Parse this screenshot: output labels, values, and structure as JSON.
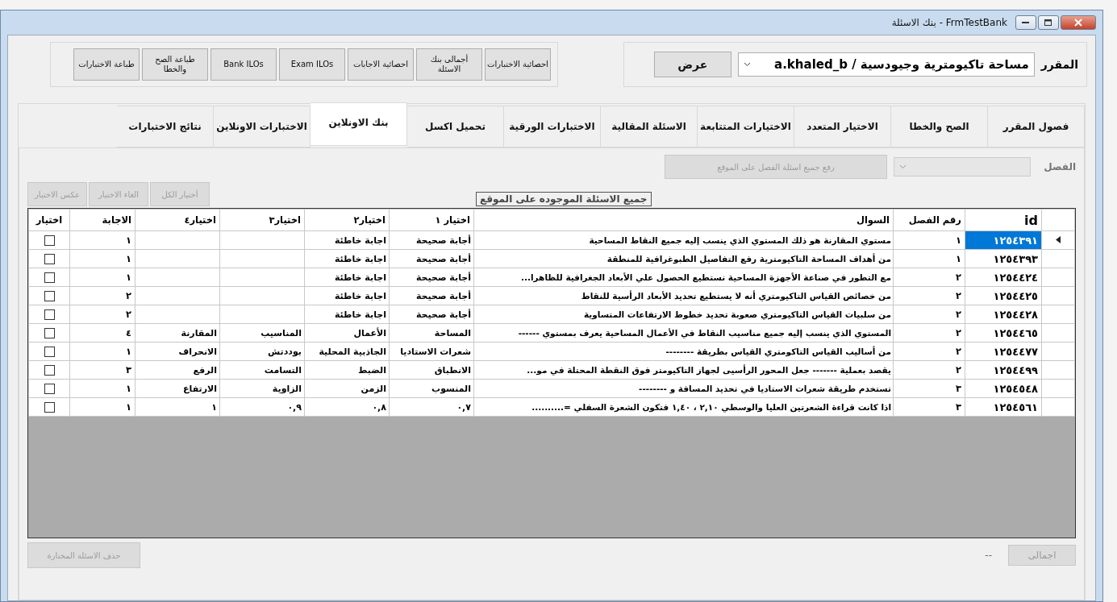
{
  "window": {
    "title": "بنك الاسئلة - FrmTestBank"
  },
  "course": {
    "label": "المقرر",
    "value": "مساحة تاكيومترية وجيودسية / a.khaled_b",
    "show_button": "عرض"
  },
  "toolbar_buttons": [
    {
      "label": "احصائية الاختبارات"
    },
    {
      "label": "أجمالى بنك الاسئلة"
    },
    {
      "label": "احصائية الاجابات"
    },
    {
      "label": "Exam ILOs"
    },
    {
      "label": "Bank ILOs"
    },
    {
      "label": "طباعة الصح والخطا"
    },
    {
      "label": "طباعة الاختبارات"
    }
  ],
  "tabs": [
    {
      "label": "فصول المقرر",
      "selected": false
    },
    {
      "label": "الصح والخطا",
      "selected": false
    },
    {
      "label": "الاختيار المتعدد",
      "selected": false
    },
    {
      "label": "الاختيارات المتتابعة",
      "selected": false
    },
    {
      "label": "الاسئلة المقالية",
      "selected": false
    },
    {
      "label": "الاختبارات الورقية",
      "selected": false
    },
    {
      "label": "تحميل اكسل",
      "selected": false
    },
    {
      "label": "بنك الاونلاين",
      "selected": true
    },
    {
      "label": "الاختبارات الاونلاين",
      "selected": false
    },
    {
      "label": "نتائج الاختبارات",
      "selected": false
    }
  ],
  "chapter": {
    "label": "الفصل",
    "upload_button": {
      "label": "رفع جميع اسئلة الفصل على الموقع",
      "disabled": true
    }
  },
  "selection_buttons": [
    {
      "label": "أختيار الكل",
      "disabled": true
    },
    {
      "label": "الغاء الاختيار",
      "disabled": true
    },
    {
      "label": "عكس الاختيار",
      "disabled": true
    }
  ],
  "grid_caption": "جميع الاسئلة الموجوده على الموقع",
  "table": {
    "columns": [
      "id",
      "رقم الفصل",
      "السوال",
      "اختيار ١",
      "اختيار٢",
      "اختيار٣",
      "اختيار٤",
      "الاجابة",
      "اختيار"
    ],
    "rows": [
      {
        "id": "١٢٥٤٣٩١",
        "chapter": "١",
        "question": "مستوي المقارنة هو ذلك المستوي الذي ينسب إليه جميع النقاط المساحية",
        "choices": [
          "أجابة صحيحة",
          "اجابة خاطئة"
        ],
        "answer": "١",
        "checked": false,
        "selected": true
      },
      {
        "id": "١٢٥٤٣٩٣",
        "chapter": "١",
        "question": "من أهداف المساحة التاكيومترية رفع التفاصيل الطبوغرافية للمنطقة",
        "choices": [
          "أجابة صحيحة",
          "اجابة خاطئة"
        ],
        "answer": "١",
        "checked": false,
        "selected": false
      },
      {
        "id": "١٢٥٤٤٢٤",
        "chapter": "٢",
        "question": "مع التطور في صناعة الأجهزة المساحية نستطيع الحصول علي الأبعاد الجغرافية للظاهرا...",
        "choices": [
          "أجابة صحيحة",
          "اجابة خاطئة"
        ],
        "answer": "١",
        "checked": false,
        "selected": false
      },
      {
        "id": "١٢٥٤٤٢٥",
        "chapter": "٢",
        "question": "من خصائص القياس التاكيومتري أنه لا يستطيع تحديد الأبعاد الرأسية للنقاط",
        "choices": [
          "أجابة صحيحة",
          "اجابة خاطئة"
        ],
        "answer": "٢",
        "checked": false,
        "selected": false
      },
      {
        "id": "١٢٥٤٤٢٨",
        "chapter": "٢",
        "question": "من سلبيات القياس التاكيومتري صعوبة تحديد خطوط الارتفاعات المتساوية",
        "choices": [
          "أجابة صحيحة",
          "اجابة خاطئة"
        ],
        "answer": "٢",
        "checked": false,
        "selected": false
      },
      {
        "id": "١٢٥٤٤٦٥",
        "chapter": "٢",
        "question": "المستوي الذي ينسب إليه جميع مناسيب النقاط في الأعمال المساحية يعرف بمستوي ------",
        "choices": [
          "المساحة",
          "الأعمال",
          "المناسيب",
          "المقارنة"
        ],
        "answer": "٤",
        "checked": false,
        "selected": false
      },
      {
        "id": "١٢٥٤٤٧٧",
        "chapter": "٢",
        "question": "من أساليب القياس التاكومتري القياس بطريقة --------",
        "choices": [
          "شعرات الاستاديا",
          "الجاذبية المحلية",
          "بوددتش",
          "الانحراف"
        ],
        "answer": "١",
        "checked": false,
        "selected": false
      },
      {
        "id": "١٢٥٤٤٩٩",
        "chapter": "٢",
        "question": "يقصد بعملية ------- جعل المحور الرأسيى لجهاز التاكيومتر  فوق النقطة المحتلة في مو...",
        "choices": [
          "الانطباق",
          "الضبط",
          "التسامت",
          "الرفع"
        ],
        "answer": "٣",
        "checked": false,
        "selected": false
      },
      {
        "id": "١٢٥٤٥٤٨",
        "chapter": "٣",
        "question": "تستخدم طريقة شعرات الاستاديا في تحديد المسافة و --------",
        "choices": [
          "المنسوب",
          "الزمن",
          "الزاوية",
          "الارتفاع"
        ],
        "answer": "١",
        "checked": false,
        "selected": false
      },
      {
        "id": "١٢٥٤٥٦١",
        "chapter": "٣",
        "question": "اذا كانت قراءة الشعرتين العليا والوسطي ٢,١٠ ، ١,٤٠ فتكون الشعرة السفلي =..........",
        "choices": [
          "٠,٧",
          "٠,٨",
          "٠,٩",
          "١"
        ],
        "answer": "١",
        "checked": false,
        "selected": false
      }
    ]
  },
  "footer": {
    "total_button": {
      "label": "اجمالى",
      "disabled": true
    },
    "total_value": "--",
    "delete_button": {
      "label": "حذف الاسئلة المختارة",
      "disabled": true
    }
  }
}
